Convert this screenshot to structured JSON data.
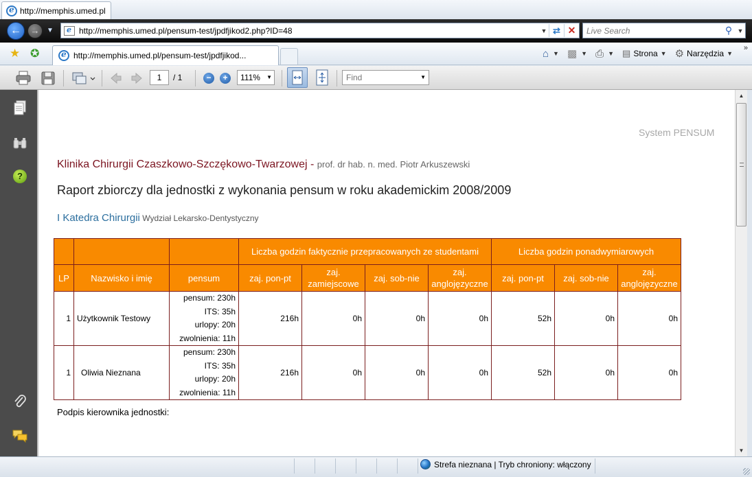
{
  "window": {
    "title": "http://memphis.umed.pl"
  },
  "navbar": {
    "address": "http://memphis.umed.pl/pensum-test/jpdfjikod2.php?ID=48",
    "search_placeholder": "Live Search"
  },
  "tabs": {
    "active_tab_title": "http://memphis.umed.pl/pensum-test/jpdfjikod..."
  },
  "commands": {
    "page_label": "Strona",
    "tools_label": "Narzędzia"
  },
  "pdf_toolbar": {
    "page_current": "1",
    "page_total": "/ 1",
    "zoom": "111%",
    "find_placeholder": "Find"
  },
  "document": {
    "system_label": "System PENSUM",
    "clinic_name": "Klinika Chirurgii Czaszkowo-Szczękowo-Twarzowej",
    "clinic_dash": " - ",
    "clinic_head": "prof. dr hab. n. med. Piotr Arkuszewski",
    "report_title": "Raport zbiorczy dla jednostki z wykonania pensum w roku akademickim 2008/2009",
    "dept_name": "I Katedra Chirurgii",
    "dept_faculty": "Wydział Lekarsko-Dentystyczny",
    "table": {
      "group_actual": "Liczba godzin faktycznie przepracowanych ze studentami",
      "group_overtime": "Liczba godzin ponadwymiarowych",
      "col_lp": "LP",
      "col_name": "Nazwisko i imię",
      "col_pensum": "pensum",
      "col_ponpt": "zaj. pon-pt",
      "col_zamiejscowe": "zaj. zamiejscowe",
      "col_sobnie": "zaj. sob-nie",
      "col_anglo": "zaj. anglojęzyczne",
      "col_ot_ponpt": "zaj. pon-pt",
      "col_ot_sobnie": "zaj. sob-nie",
      "col_ot_anglo": "zaj. anglojęzyczne",
      "rows": [
        {
          "lp": "1",
          "name": "Użytkownik Testowy",
          "pensum": "pensum: 230h",
          "its": "ITS: 35h",
          "urlopy": "urlopy: 20h",
          "zwolnienia": "zwolnienia: 11h",
          "ponpt": "216h",
          "zamiejscowe": "0h",
          "sobnie": "0h",
          "anglo": "0h",
          "ot_ponpt": "52h",
          "ot_sobnie": "0h",
          "ot_anglo": "0h"
        },
        {
          "lp": "1",
          "name": "Oliwia Nieznana",
          "pensum": "pensum: 230h",
          "its": "ITS: 35h",
          "urlopy": "urlopy: 20h",
          "zwolnienia": "zwolnienia: 11h",
          "ponpt": "216h",
          "zamiejscowe": "0h",
          "sobnie": "0h",
          "anglo": "0h",
          "ot_ponpt": "52h",
          "ot_sobnie": "0h",
          "ot_anglo": "0h"
        }
      ]
    },
    "signature": "Podpis kierownika jednostki:"
  },
  "statusbar": {
    "zone": "Strefa nieznana | Tryb chroniony: włączony"
  }
}
